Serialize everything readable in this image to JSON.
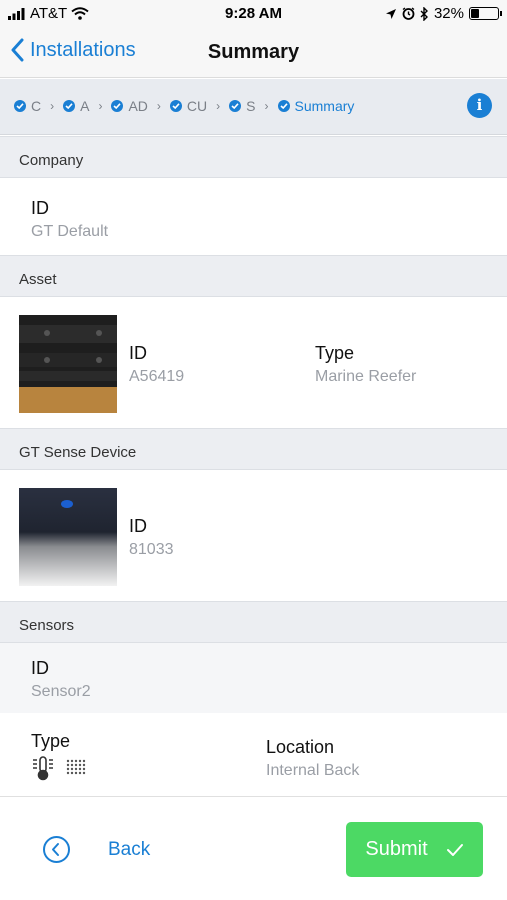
{
  "status_bar": {
    "carrier": "AT&T",
    "time": "9:28 AM",
    "battery": "32%",
    "battery_level": 0.32,
    "icons": [
      "signal-icon",
      "wifi-icon",
      "location-icon",
      "alarm-icon",
      "bluetooth-icon",
      "battery-icon"
    ]
  },
  "nav": {
    "back_label": "Installations",
    "title": "Summary"
  },
  "stepper": {
    "steps": [
      {
        "label": "C",
        "active": false
      },
      {
        "label": "A",
        "active": false
      },
      {
        "label": "AD",
        "active": false
      },
      {
        "label": "CU",
        "active": false
      },
      {
        "label": "S",
        "active": false
      },
      {
        "label": "Summary",
        "active": true
      }
    ],
    "accent": "#1a7fd4"
  },
  "company": {
    "header": "Company",
    "id_label": "ID",
    "id_value": "GT Default"
  },
  "asset": {
    "header": "Asset",
    "id_label": "ID",
    "id_value": "A56419",
    "type_label": "Type",
    "type_value": "Marine Reefer"
  },
  "device": {
    "header": "GT Sense Device",
    "id_label": "ID",
    "id_value": "81033"
  },
  "sensors": {
    "header": "Sensors",
    "id_label": "ID",
    "id_value": "Sensor2",
    "type_label": "Type",
    "type_icons": [
      "thermometer-icon",
      "humidity-icon"
    ],
    "location_label": "Location",
    "location_value": "Internal Back"
  },
  "footer": {
    "back_label": "Back",
    "submit_label": "Submit",
    "submit_color": "#4cd964"
  }
}
